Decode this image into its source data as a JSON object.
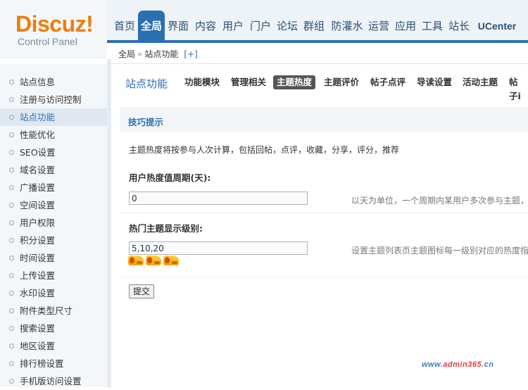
{
  "logo": {
    "brand": "Discuz!",
    "subtitle": "Control Panel"
  },
  "nav": {
    "tabs": [
      {
        "label": "首页"
      },
      {
        "label": "全局",
        "active": true
      },
      {
        "label": "界面"
      },
      {
        "label": "内容"
      },
      {
        "label": "用户"
      },
      {
        "label": "门户"
      },
      {
        "label": "论坛"
      },
      {
        "label": "群组"
      },
      {
        "label": "防灌水"
      },
      {
        "label": "运营"
      },
      {
        "label": "应用"
      },
      {
        "label": "工具"
      },
      {
        "label": "站长"
      },
      {
        "label": "UCenter"
      }
    ],
    "accent_color": "#2a6fb2"
  },
  "breadcrumb": {
    "root": "全局",
    "separator": "»",
    "current": "站点功能",
    "add": "[+]"
  },
  "sidebar": {
    "items": [
      {
        "label": "站点信息"
      },
      {
        "label": "注册与访问控制"
      },
      {
        "label": "站点功能",
        "active": true
      },
      {
        "label": "性能优化"
      },
      {
        "label": "SEO设置"
      },
      {
        "label": "域名设置"
      },
      {
        "label": "广播设置"
      },
      {
        "label": "空间设置"
      },
      {
        "label": "用户权限"
      },
      {
        "label": "积分设置"
      },
      {
        "label": "时间设置"
      },
      {
        "label": "上传设置"
      },
      {
        "label": "水印设置"
      },
      {
        "label": "附件类型尺寸"
      },
      {
        "label": "搜索设置"
      },
      {
        "label": "地区设置"
      },
      {
        "label": "排行榜设置"
      },
      {
        "label": "手机版访问设置"
      }
    ]
  },
  "main": {
    "section_title": "站点功能",
    "sub_tabs": [
      {
        "label": "功能模块"
      },
      {
        "label": "管理相关"
      },
      {
        "label": "主题热度",
        "active": true
      },
      {
        "label": "主题评价"
      },
      {
        "label": "帖子点评"
      },
      {
        "label": "导读设置"
      },
      {
        "label": "活动主题"
      },
      {
        "label": "帖子i"
      }
    ],
    "tips_title": "技巧提示",
    "tips_text": "主题热度将按参与人次计算，包括回帖，点评，收藏，分享，评分，推荐",
    "field1": {
      "label": "用户热度值周期(天):",
      "value": "0",
      "hint": "以天为单位，一个周期内某用户多次参与主题，"
    },
    "field2": {
      "label": "热门主题显示级别:",
      "value": "5,10,20",
      "hint": "设置主题列表页主题图标每一级别对应的热度指"
    },
    "fire_icons": [
      "fire-level-1-icon",
      "fire-level-2-icon",
      "fire-level-3-icon"
    ],
    "submit_label": "提交"
  },
  "watermark": {
    "prefix": "www.",
    "brand": "admin365",
    "suffix": ".cn"
  }
}
